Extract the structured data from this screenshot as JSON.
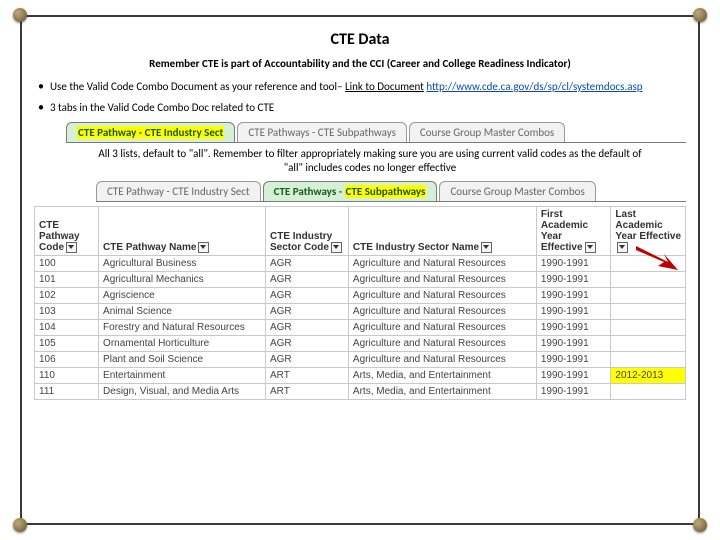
{
  "title": "CTE Data",
  "subtitle": "Remember CTE is part of Accountability and the CCI (Career and College Readiness Indicator)",
  "bullets": {
    "one_prefix": "Use the Valid Code Combo Document as your reference and tool– ",
    "one_link_label": "Link to Document",
    "one_link_url": "http://www.cde.ca.gov/ds/sp/cl/systemdocs.asp",
    "two": "3 tabs in the Valid Code Combo Doc related to CTE"
  },
  "tabs_top": [
    {
      "label_hl": "CTE Pathway - CTE Industry Sect",
      "active": true
    },
    {
      "label": "CTE Pathways - CTE Subpathways",
      "active": false
    },
    {
      "label": "Course Group Master Combos",
      "active": false
    }
  ],
  "note": "All 3 lists, default to \"all\".  Remember to filter appropriately making sure you are using current valid codes as the default of \"all\" includes codes no longer effective",
  "tabs_mid": [
    {
      "label": "CTE Pathway - CTE Industry Sect",
      "active": false
    },
    {
      "label_pre": "CTE Pathways - ",
      "label_hl": "CTE Subpathways",
      "active": true
    },
    {
      "label": "Course Group Master Combos",
      "active": false
    }
  ],
  "table": {
    "headers": {
      "code": "CTE Pathway Code",
      "name": "CTE Pathway Name",
      "sector": "CTE Industry Sector Code",
      "sectorname": "CTE Industry Sector Name",
      "first": "First Academic Year Effective",
      "last": "Last Academic Year Effective"
    },
    "rows": [
      {
        "code": "100",
        "name": "Agricultural Business",
        "sector": "AGR",
        "sectorname": "Agriculture and Natural Resources",
        "first": "1990-1991",
        "last": ""
      },
      {
        "code": "101",
        "name": "Agricultural Mechanics",
        "sector": "AGR",
        "sectorname": "Agriculture and Natural Resources",
        "first": "1990-1991",
        "last": ""
      },
      {
        "code": "102",
        "name": "Agriscience",
        "sector": "AGR",
        "sectorname": "Agriculture and Natural Resources",
        "first": "1990-1991",
        "last": ""
      },
      {
        "code": "103",
        "name": "Animal Science",
        "sector": "AGR",
        "sectorname": "Agriculture and Natural Resources",
        "first": "1990-1991",
        "last": ""
      },
      {
        "code": "104",
        "name": "Forestry and Natural Resources",
        "sector": "AGR",
        "sectorname": "Agriculture and Natural Resources",
        "first": "1990-1991",
        "last": ""
      },
      {
        "code": "105",
        "name": "Ornamental Horticulture",
        "sector": "AGR",
        "sectorname": "Agriculture and Natural Resources",
        "first": "1990-1991",
        "last": ""
      },
      {
        "code": "106",
        "name": "Plant and Soil Science",
        "sector": "AGR",
        "sectorname": "Agriculture and Natural Resources",
        "first": "1990-1991",
        "last": ""
      },
      {
        "code": "110",
        "name": "Entertainment",
        "sector": "ART",
        "sectorname": "Arts, Media, and Entertainment",
        "first": "1990-1991",
        "last": "2012-2013",
        "last_hl": true
      },
      {
        "code": "111",
        "name": "Design, Visual, and Media Arts",
        "sector": "ART",
        "sectorname": "Arts, Media, and Entertainment",
        "first": "1990-1991",
        "last": ""
      }
    ]
  }
}
